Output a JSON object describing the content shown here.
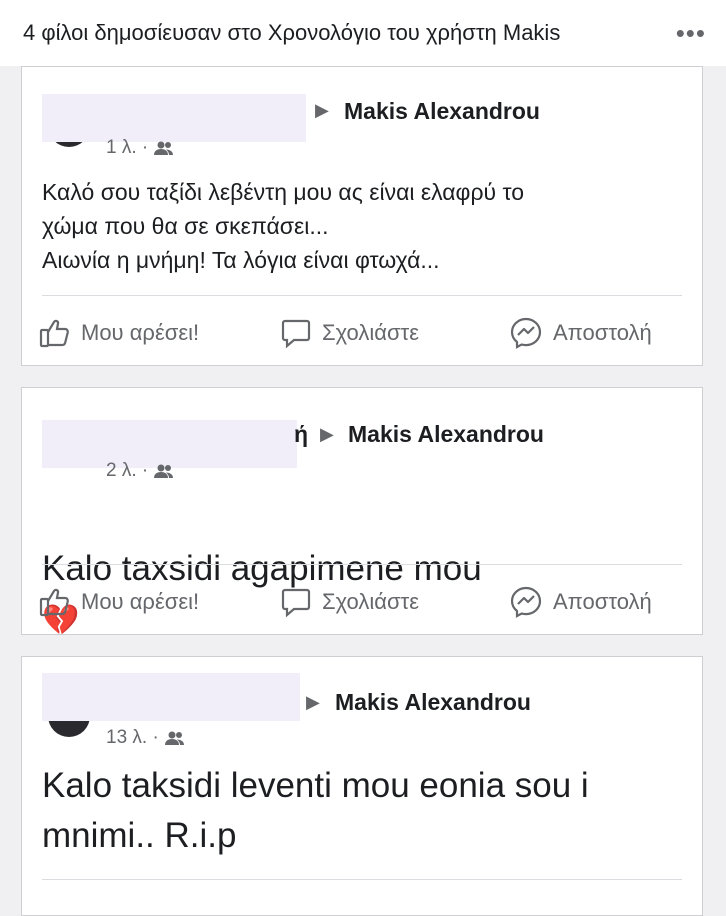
{
  "header": {
    "title": "4 φίλοι δημοσίευσαν στο Χρονολόγιο του χρήστη Makis",
    "more_label": "•••"
  },
  "posts": [
    {
      "target_name": "Makis Alexandrou",
      "author_partial": "",
      "time": "1 λ. ·",
      "text": "Καλό σου ταξίδι λεβέντη μου ας είναι ελαφρύ το\nχώμα που θα σε σκεπάσει...\nΑιωνία η μνήμη!  Τα λόγια είναι φτωχά...",
      "text_size": "small"
    },
    {
      "target_name": "Makis Alexandrou",
      "author_partial": "ή",
      "time": "2 λ. ·",
      "text": "Kalo taxsidi agapimene mou",
      "emoji": "💔",
      "text_size": "big"
    },
    {
      "target_name": "Makis Alexandrou",
      "author_partial": "",
      "time": "13 λ. ·",
      "text": "Kalo taksidi leventi mou eonia sou i\nmnimi.. R.i.p",
      "text_size": "big"
    }
  ],
  "actions": {
    "like": "Μου αρέσει!",
    "comment": "Σχολιάστε",
    "share": "Αποστολή"
  },
  "icons": {
    "like": "thumbs-up-icon",
    "comment": "comment-bubble-icon",
    "share": "messenger-icon",
    "audience": "friends-icon"
  },
  "colors": {
    "text": "#1c1e21",
    "secondary": "#65676b",
    "redaction": "#f1eef9"
  }
}
